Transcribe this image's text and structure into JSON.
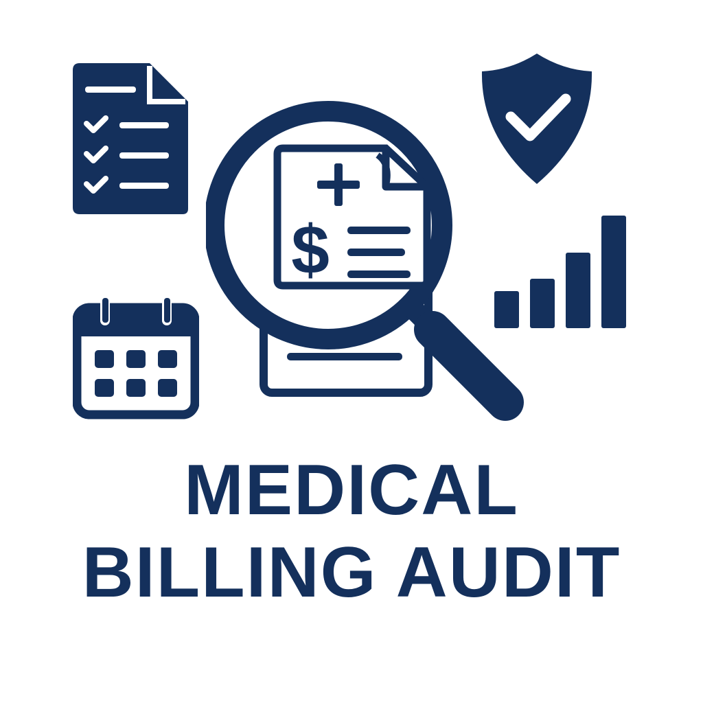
{
  "title": {
    "line1": "MEDICAL",
    "line2": "BILLING AUDIT"
  },
  "icons": [
    "checklist-document-icon",
    "shield-check-icon",
    "magnifying-glass-icon",
    "medical-bill-icon",
    "calendar-icon",
    "bar-chart-icon"
  ],
  "colors": {
    "primary": "#14305c",
    "background": "#ffffff"
  },
  "bar_chart_levels": [
    0.33,
    0.44,
    0.67,
    1.0
  ]
}
